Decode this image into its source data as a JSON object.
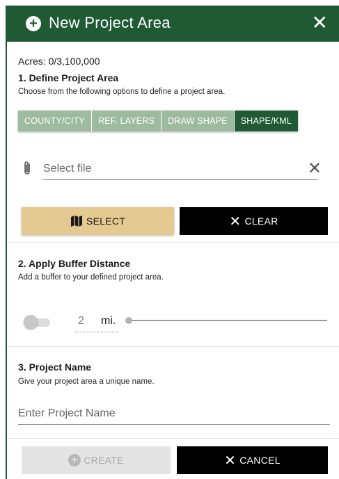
{
  "header": {
    "title": "New Project Area",
    "close_glyph": "✕",
    "icons": [
      "plus-circle-icon",
      "close-icon"
    ]
  },
  "acres": "Acres: 0/3,100,000",
  "section1": {
    "title": "1. Define Project Area",
    "description": "Choose from the following options to define a project area.",
    "tabs": [
      {
        "label": "COUNTY/CITY",
        "active": false
      },
      {
        "label": "REF. LAYERS",
        "active": false
      },
      {
        "label": "DRAW SHAPE",
        "active": false
      },
      {
        "label": "SHAPE/KML",
        "active": true
      }
    ],
    "file": {
      "placeholder": "Select file",
      "clear_glyph": "✕",
      "icon": "paperclip-icon"
    },
    "select_button": {
      "label": "SELECT",
      "icon": "map-icon"
    },
    "clear_button": {
      "label": "CLEAR",
      "icon": "close-icon",
      "glyph": "✕"
    }
  },
  "section2": {
    "title": "2. Apply Buffer Distance",
    "description": "Add a buffer to your defined project area.",
    "toggle_on": false,
    "buffer_value": "2",
    "unit": "mi."
  },
  "section3": {
    "title": "3. Project Name",
    "description": "Give your project area a unique name.",
    "name_placeholder": "Enter Project Name"
  },
  "footer": {
    "create_button": {
      "label": "CREATE",
      "glyph": "+",
      "disabled": true
    },
    "cancel_button": {
      "label": "CANCEL",
      "glyph": "✕"
    }
  },
  "colors": {
    "brand_green": "#1f5a34",
    "tab_inactive": "#9dbb9f",
    "select_gold": "#e4ca90"
  }
}
